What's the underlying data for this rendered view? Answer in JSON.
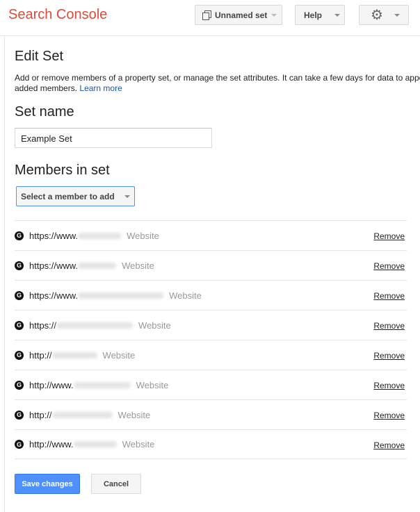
{
  "header": {
    "logo": "Search Console",
    "set_menu": "Unnamed set",
    "help": "Help",
    "settings_icon": "gear-icon"
  },
  "page": {
    "title": "Edit Set",
    "description": "Add or remove members of a property set, or manage the set attributes. It can take a few days for data to appear for newly",
    "description_line2": "added members.",
    "learn_more": "Learn more"
  },
  "set_name": {
    "heading": "Set name",
    "value": "Example Set"
  },
  "members": {
    "heading": "Members in set",
    "select_label": "Select a member to add",
    "remove_label": "Remove",
    "items": [
      {
        "prefix": "https://www.",
        "type": "Website"
      },
      {
        "prefix": "https://www.",
        "type": "Website"
      },
      {
        "prefix": "https://www.",
        "type": "Website"
      },
      {
        "prefix": "https://",
        "type": "Website"
      },
      {
        "prefix": "http://",
        "type": "Website"
      },
      {
        "prefix": "http://www.",
        "type": "Website"
      },
      {
        "prefix": "http://",
        "type": "Website"
      },
      {
        "prefix": "http://www.",
        "type": "Website"
      }
    ]
  },
  "actions": {
    "save": "Save changes",
    "cancel": "Cancel"
  },
  "colors": {
    "brand": "#dd4b39",
    "primary": "#4d90fe",
    "link": "#1155cc"
  }
}
